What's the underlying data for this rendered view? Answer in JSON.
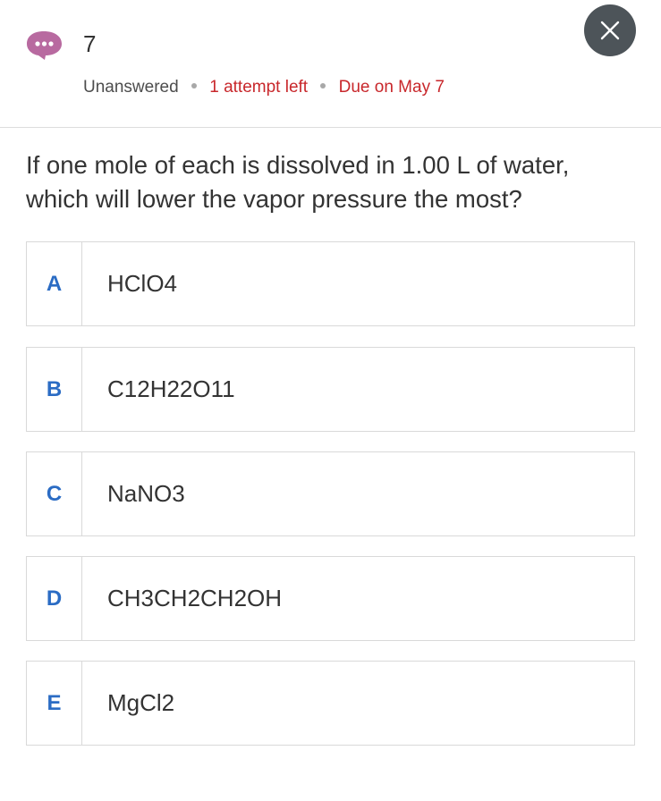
{
  "header": {
    "question_number": "7",
    "status": {
      "state": "Unanswered",
      "attempts": "1 attempt left",
      "due": "Due on May 7"
    },
    "chat_icon": "chat-bubble-icon",
    "close_icon": "close-icon"
  },
  "question": {
    "text": "If one mole of each is dissolved in 1.00 L of water, which will lower the vapor pressure the most?"
  },
  "options": [
    {
      "letter": "A",
      "text": "HClO4"
    },
    {
      "letter": "B",
      "text": "C12H22O11"
    },
    {
      "letter": "C",
      "text": "NaNO3"
    },
    {
      "letter": "D",
      "text": "CH3CH2CH2OH"
    },
    {
      "letter": "E",
      "text": "MgCl2"
    }
  ],
  "colors": {
    "accent": "#2b6cc4",
    "alert": "#c8272b",
    "chat_icon": "#b86aa0",
    "close_button": "#4d5459"
  }
}
